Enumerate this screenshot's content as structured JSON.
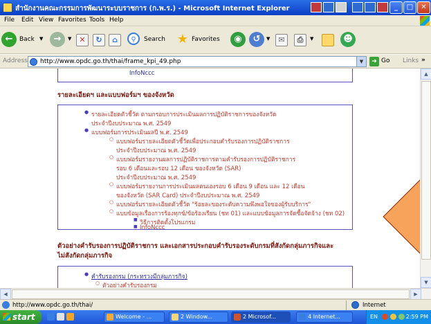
{
  "window": {
    "title": "สำนักงานคณะกรรมการพัฒนาระบบราชการ (ก.พ.ร.) - Microsoft Internet Explorer"
  },
  "menu": [
    "File",
    "Edit",
    "View",
    "Favorites",
    "Tools",
    "Help"
  ],
  "toolbar": {
    "back_label": "Back",
    "search_label": "Search",
    "favorites_label": "Favorites"
  },
  "address": {
    "label": "Address",
    "url": "http://www.opdc.go.th/thai/frame_kpi_49.php",
    "go_label": "Go",
    "links_label": "Links"
  },
  "content": {
    "top_cut_text": "InfoNccc",
    "section1": {
      "heading": "รายละเอียดฯ และแบบฟอร์มฯ ของจังหวัด",
      "items": [
        {
          "text": "รายละเอียดตัวชี้วัด ตามกรอบการประเมินผลการปฏิบัติราชการของจังหวัด",
          "level": 1
        },
        {
          "text": "ประจำปีงบประมาณ พ.ศ. 2549",
          "level": 1,
          "cont": true
        },
        {
          "text": "แบบฟอร์มการประเมินผลปี พ.ศ. 2549",
          "level": 1
        },
        {
          "text": "แบบฟอร์มรายละเอียดตัวชี้วัดเพื่อประกอบคำรับรองการปฏิบัติราชการ",
          "level": 2
        },
        {
          "text": "ประจำปีงบประมาณ พ.ศ. 2549",
          "level": 2,
          "cont": true
        },
        {
          "text": "แบบฟอร์มรายงานผลการปฏิบัติราชการตามคำรับรองการปฏิบัติราชการ",
          "level": 2
        },
        {
          "text": "รอบ 6 เดือนและรอบ 12 เดือน ของจังหวัด (SAR)",
          "level": 2,
          "cont": true
        },
        {
          "text": "ประจำปีงบประมาณ พ.ศ. 2549",
          "level": 2,
          "cont": true
        },
        {
          "text": "แบบฟอร์มรายงานการประเมินผลตนเองรอบ 6 เดือน 9 เดือน และ 12 เดือน",
          "level": 2
        },
        {
          "text": "ของจังหวัด (SAR Card) ประจำปีงบประมาณ พ.ศ. 2549",
          "level": 2,
          "cont": true
        },
        {
          "text": "แบบฟอร์มรายละเอียดตัวชี้วัด \"ร้อยละของระดับความพึงพอใจของผู้รับบริการ\"",
          "level": 2
        },
        {
          "text": "แบบข้อมูลเรื่องการร้องทุกข์/ข้อร้องเรียน (ชท 01) และแบบข้อมูลการจัดซื้อจัดจ้าง (ชท 02)",
          "level": 2
        },
        {
          "text": "วิธีการติดตั้งโปรแกรม",
          "level": 3
        },
        {
          "text": "InfoNccc",
          "level": 3
        }
      ]
    },
    "section2": {
      "heading_line1": "ตัวอย่างคำรับรองการปฏิบัติราชการ และเอกสารประกอบคำรับรองระดับกรมที่สังกัดกลุ่มภารกิจและ",
      "heading_line2": "ไม่สังกัดกลุ่มภารกิจ",
      "items": [
        {
          "text": "คำรับรองกรม (กระทรวงมีกลุ่มภารกิจ)",
          "level": 1
        },
        {
          "text": "ตัวอย่างคำรับรองกรม",
          "level": 2
        }
      ]
    }
  },
  "status": {
    "text": "http://www.opdc.go.th/thai/",
    "zone": "Internet"
  },
  "taskbar": {
    "start": "start",
    "tasks": [
      "Welcome - ...",
      "2 Window...",
      "2 Microsof...",
      "4 Internet..."
    ],
    "tray_lang": "EN",
    "clock": "2:59 PM"
  }
}
